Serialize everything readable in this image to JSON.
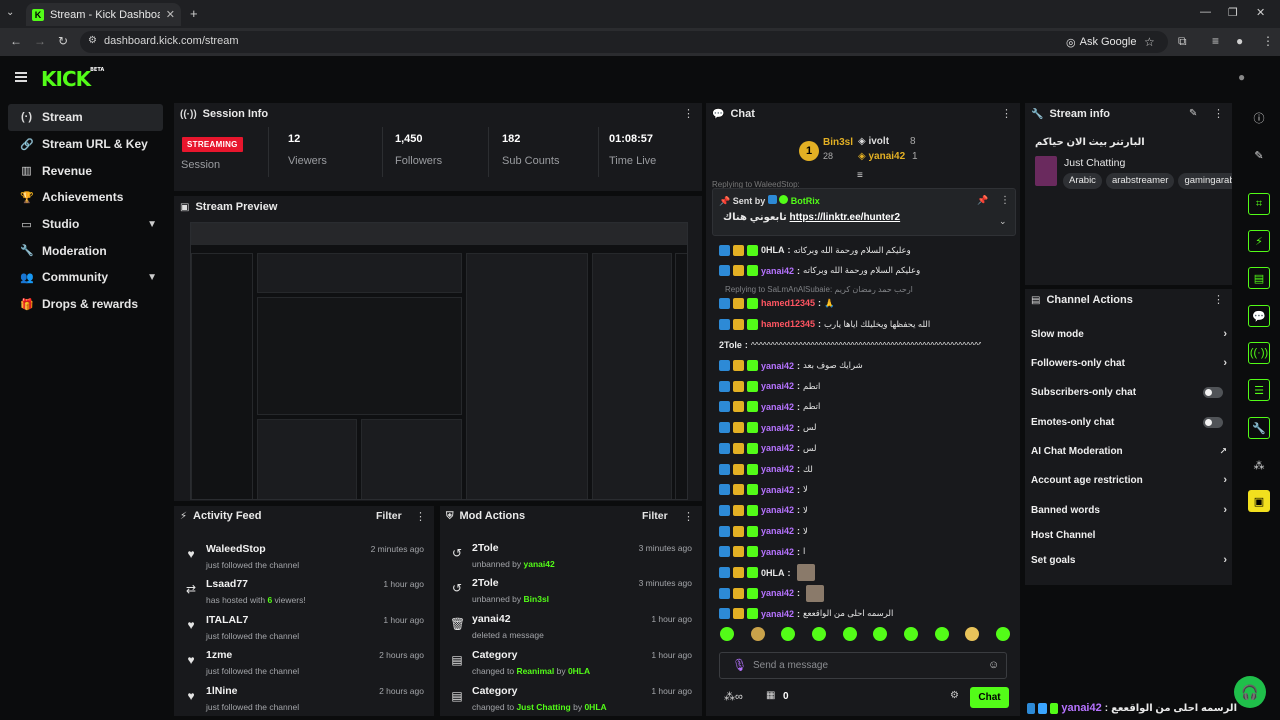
{
  "browser": {
    "tab_title": "Stream - Kick Dashboard",
    "url": "dashboard.kick.com/stream",
    "ask_google": "Ask Google"
  },
  "brand": {
    "logo": "KICK",
    "beta": "BETA"
  },
  "sidebar": {
    "items": [
      {
        "label": "Stream",
        "icon": "radio-icon"
      },
      {
        "label": "Stream URL & Key",
        "icon": "link-icon"
      },
      {
        "label": "Revenue",
        "icon": "chart-icon"
      },
      {
        "label": "Achievements",
        "icon": "trophy-icon"
      },
      {
        "label": "Studio",
        "icon": "monitor-icon"
      },
      {
        "label": "Moderation",
        "icon": "wrench-icon"
      },
      {
        "label": "Community",
        "icon": "people-icon"
      },
      {
        "label": "Drops & rewards",
        "icon": "gift-icon"
      }
    ]
  },
  "session": {
    "title": "Session Info",
    "badge": "STREAMING",
    "session_label": "Session",
    "viewers": "12",
    "viewers_label": "Viewers",
    "followers": "1,450",
    "followers_label": "Followers",
    "subs": "182",
    "subs_label": "Sub Counts",
    "time": "01:08:57",
    "time_label": "Time Live"
  },
  "preview": {
    "title": "Stream Preview"
  },
  "activity": {
    "title": "Activity Feed",
    "filter": "Filter",
    "rows": [
      {
        "name": "WaleedStop",
        "desc": "just followed the channel",
        "time": "2 minutes ago"
      },
      {
        "name": "Lsaad77",
        "desc_pre": "has hosted with ",
        "desc_num": "6",
        "desc_post": " viewers!",
        "time": "1 hour ago"
      },
      {
        "name": "ITALAL7",
        "desc": "just followed the channel",
        "time": "1 hour ago"
      },
      {
        "name": "1zme",
        "desc": "just followed the channel",
        "time": "2 hours ago"
      },
      {
        "name": "1lNine",
        "desc": "just followed the channel",
        "time": "2 hours ago"
      }
    ]
  },
  "modactions": {
    "title": "Mod Actions",
    "filter": "Filter",
    "rows": [
      {
        "name": "2Tole",
        "desc_pre": "unbanned by ",
        "desc_by": "yanai42",
        "time": "3 minutes ago"
      },
      {
        "name": "2Tole",
        "desc_pre": "unbanned by ",
        "desc_by": "Bin3sl",
        "time": "3 minutes ago"
      },
      {
        "name": "yanai42",
        "desc_pre": "deleted a message",
        "desc_by": "",
        "time": "1 hour ago"
      },
      {
        "name": "Category",
        "desc_pre": "changed to ",
        "desc_cat": "Reanimal",
        "desc_by": "0HLA",
        "time": "1 hour ago"
      },
      {
        "name": "Category",
        "desc_pre": "changed to ",
        "desc_cat": "Just Chatting",
        "desc_by": "0HLA",
        "time": "1 hour ago"
      }
    ]
  },
  "chat": {
    "title": "Chat",
    "top": {
      "rank1": "Bin3sl",
      "rank1_sub": "28",
      "rank2": "ivolt",
      "rank2_num": "8",
      "rank3": "yanai42",
      "rank3_num": "1",
      "rank1_badge": "1"
    },
    "pinned_reply_hint": "Replying to WaleedStop:",
    "pinned_sent_by": "Sent by",
    "pinned_user": "BotRix",
    "pinned_text_ar": "تابعوني هناك",
    "pinned_link": "https://linktr.ee/hunter2",
    "messages": [
      {
        "user": "0HLA",
        "color": "g",
        "text": "وعليكم السلام ورحمة الله وبركاته"
      },
      {
        "user": "yanai42",
        "color": "p",
        "text": "وعليكم السلام ورحمة الله وبركاته"
      },
      {
        "reply": "Replying to SaLmAnAlSubaie: ارحب حمد رمضان كريم"
      },
      {
        "user": "hamed12345",
        "color": "r",
        "text": "🙏"
      },
      {
        "user": "hamed12345",
        "color": "r",
        "text": "الله يحفظها ويخليلك اياها يارب"
      },
      {
        "user": "2Tole",
        "color": "w",
        "text": "^^^^^^^^^^^^^^^^^^^^^^^^^^^^^^^^^^^^^^^^^^^^^^^^^^^^^^^^^^"
      },
      {
        "user": "yanai42",
        "color": "p",
        "text": "شرايك صوف بعد"
      },
      {
        "user": "yanai42",
        "color": "p",
        "text": "اتطم"
      },
      {
        "user": "yanai42",
        "color": "p",
        "text": "اتطم"
      },
      {
        "user": "yanai42",
        "color": "p",
        "text": "لس"
      },
      {
        "user": "yanai42",
        "color": "p",
        "text": "لس"
      },
      {
        "user": "yanai42",
        "color": "p",
        "text": "لك"
      },
      {
        "user": "yanai42",
        "color": "p",
        "text": "لا"
      },
      {
        "user": "yanai42",
        "color": "p",
        "text": "لا"
      },
      {
        "user": "yanai42",
        "color": "p",
        "text": "لا"
      },
      {
        "user": "yanai42",
        "color": "p",
        "text": "ا"
      },
      {
        "user": "0HLA",
        "color": "g",
        "text": ""
      },
      {
        "user": "yanai42",
        "color": "p",
        "text": ""
      },
      {
        "user": "yanai42",
        "color": "p",
        "text": "الرسمه احلى من الواقععع"
      }
    ],
    "input_placeholder": "Send a message",
    "send_label": "Chat",
    "points": "0"
  },
  "streaminfo": {
    "title": "Stream info",
    "stream_title": "البارتنر بيث الان حياكم",
    "category": "Just Chatting",
    "tags": [
      "Arabic",
      "arabstreamer",
      "gamingarab"
    ]
  },
  "channel_actions": {
    "title": "Channel Actions",
    "items": [
      {
        "label": "Slow mode",
        "ctrl": "chev"
      },
      {
        "label": "Followers-only chat",
        "ctrl": "chev"
      },
      {
        "label": "Subscribers-only chat",
        "ctrl": "toggle"
      },
      {
        "label": "Emotes-only chat",
        "ctrl": "toggle"
      },
      {
        "label": "AI Chat Moderation",
        "ctrl": "ext"
      },
      {
        "label": "Account age restriction",
        "ctrl": "chev"
      },
      {
        "label": "Banned words",
        "ctrl": "chev"
      },
      {
        "label": "Host Channel",
        "ctrl": "none"
      },
      {
        "label": "Set goals",
        "ctrl": "chev"
      }
    ]
  },
  "bottom_ticker": {
    "user": "yanai42",
    "text": "الرسمه احلى من الواقععع"
  },
  "colors": {
    "accent": "#53fc18",
    "live": "#e8162d",
    "panel": "#18191c"
  }
}
